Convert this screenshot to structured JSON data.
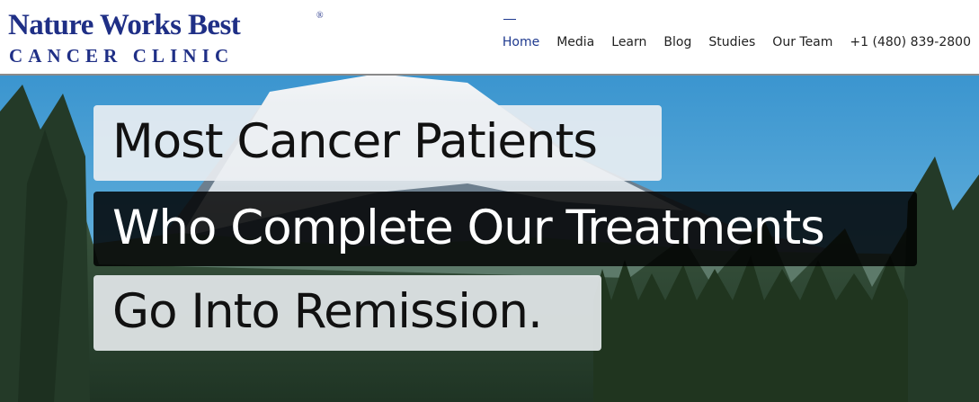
{
  "logo": {
    "name": "Nature Works Best",
    "registered": "®",
    "subtitle": "CANCER CLINIC"
  },
  "nav": {
    "items": [
      {
        "label": "Home",
        "active": true
      },
      {
        "label": "Media"
      },
      {
        "label": "Learn"
      },
      {
        "label": "Blog"
      },
      {
        "label": "Studies"
      },
      {
        "label": "Our Team"
      },
      {
        "label": "+1 (480) 839-2800"
      }
    ]
  },
  "hero": {
    "line1": "Most Cancer Patients",
    "line2": "Who Complete Our Treatments",
    "line3": "Go Into Remission.",
    "image": "mountain-forest-background"
  },
  "colors": {
    "brand": "#1f2f86",
    "nav_active": "#1f3a8f",
    "sky": "#4aa3d6"
  }
}
